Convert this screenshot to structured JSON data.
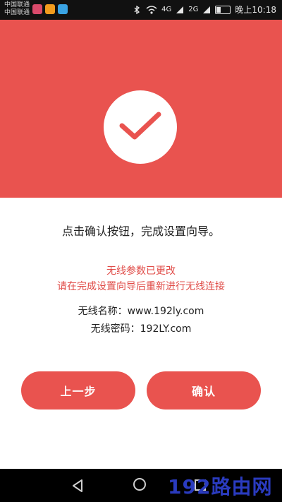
{
  "status_bar": {
    "carrier_1": "中国联通",
    "carrier_2": "中国联通",
    "net_1": "4G",
    "net_2": "2G",
    "time": "晚上10:18"
  },
  "main": {
    "instruction": "点击确认按钮，完成设置向导。",
    "warning_line_1": "无线参数已更改",
    "warning_line_2": "请在完成设置向导后重新进行无线连接",
    "wifi_name": "无线名称：www.192ly.com",
    "wifi_password": "无线密码：192LY.com"
  },
  "buttons": {
    "prev_label": "上一步",
    "confirm_label": "确认"
  },
  "watermark": "192路由网",
  "colors": {
    "accent": "#e9534f",
    "warning_text": "#e04b47",
    "watermark": "#2a3bbf"
  }
}
